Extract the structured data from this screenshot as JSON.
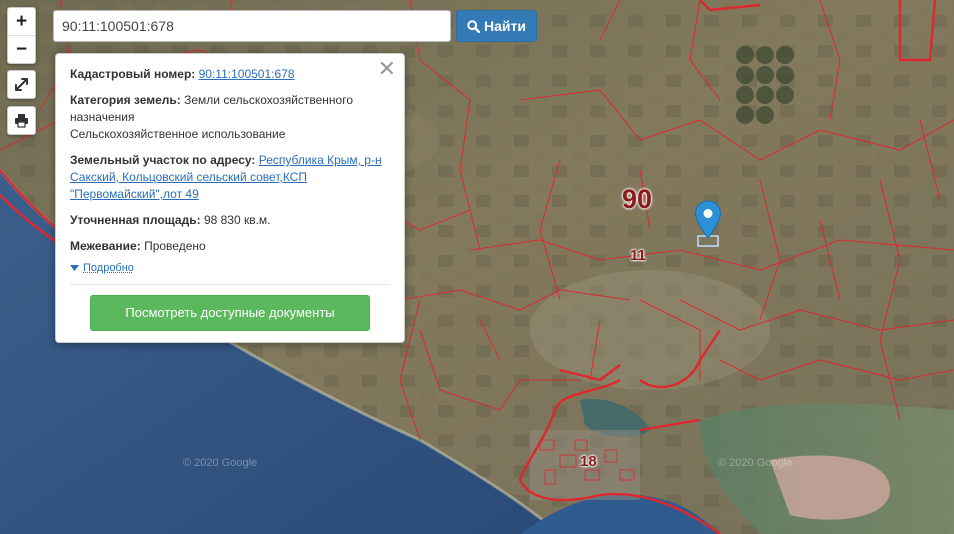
{
  "map": {
    "zoom_in": "+",
    "zoom_out": "−",
    "region_label": "90",
    "district_label": "11",
    "city_label": "18",
    "copyright": "© 2020 Google",
    "marker_icon": "map-pin-icon",
    "fullscreen_icon": "expand-icon",
    "print_icon": "printer-icon"
  },
  "search": {
    "value": "90:11:100501:678",
    "button_label": "Найти",
    "button_icon": "search-icon"
  },
  "popup": {
    "cadastral_label": "Кадастровый номер:",
    "cadastral_value": "90:11:100501:678",
    "category_label": "Категория земель:",
    "category_value": "Земли сельскохозяйственного назначения",
    "category_usage": "Сельскохозяйственное использование",
    "address_label": "Земельный участок по адресу:",
    "address_value": "Республика Крым, р-н Сакский, Кольцовский сельский совет,КСП \"Первомайский\",лот 49",
    "area_label": "Уточненная площадь:",
    "area_value": "98 830 кв.м.",
    "survey_label": "Межевание:",
    "survey_value": "Проведено",
    "more_label": "Подробно",
    "docs_button": "Посмотреть доступные документы",
    "close_icon": "close-icon"
  },
  "colors": {
    "parcel_border": "#e0262e",
    "search_button": "#337ab7",
    "docs_button": "#5cb85c",
    "link": "#2a6ebb",
    "marker": "#2d8fd5"
  }
}
